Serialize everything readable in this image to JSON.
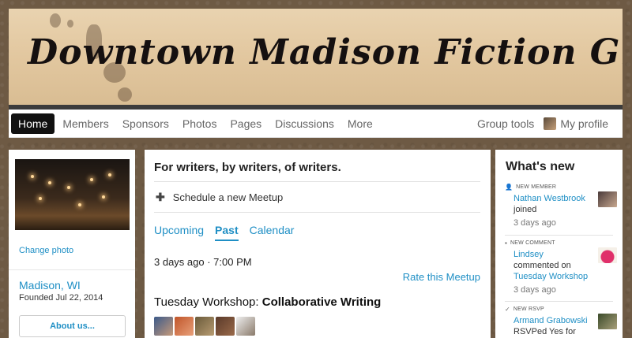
{
  "banner": {
    "title": "Downtown Madison Fiction Group"
  },
  "nav": {
    "items": [
      {
        "label": "Home",
        "active": true
      },
      {
        "label": "Members"
      },
      {
        "label": "Sponsors"
      },
      {
        "label": "Photos"
      },
      {
        "label": "Pages"
      },
      {
        "label": "Discussions"
      },
      {
        "label": "More"
      }
    ],
    "group_tools": "Group tools",
    "my_profile": "My profile"
  },
  "left": {
    "change_photo": "Change photo",
    "location": "Madison, WI",
    "founded": "Founded Jul 22, 2014",
    "about_button": "About us..."
  },
  "main": {
    "tagline": "For writers, by writers, of writers.",
    "schedule": "Schedule a new Meetup",
    "tabs": [
      {
        "label": "Upcoming"
      },
      {
        "label": "Past",
        "active": true
      },
      {
        "label": "Calendar"
      }
    ],
    "event_time": "3 days ago · 7:00 PM",
    "rate_link": "Rate this Meetup",
    "event_title_prefix": "Tuesday Workshop: ",
    "event_title_bold": "Collaborative Writing"
  },
  "right": {
    "heading": "What's new",
    "feed": [
      {
        "kind": "NEW MEMBER",
        "name": "Nathan Westbrook",
        "text": "joined",
        "time": "3 days ago"
      },
      {
        "kind": "NEW COMMENT",
        "name": "Lindsey",
        "text": "commented on",
        "link": "Tuesday Workshop",
        "time": "3 days ago"
      },
      {
        "kind": "NEW RSVP",
        "name": "Armand Grabowski",
        "text": "RSVPed Yes for"
      }
    ]
  },
  "colors": {
    "link": "#1f8fc5",
    "nav_active_bg": "#111111",
    "page_bg": "#6e5a44"
  }
}
